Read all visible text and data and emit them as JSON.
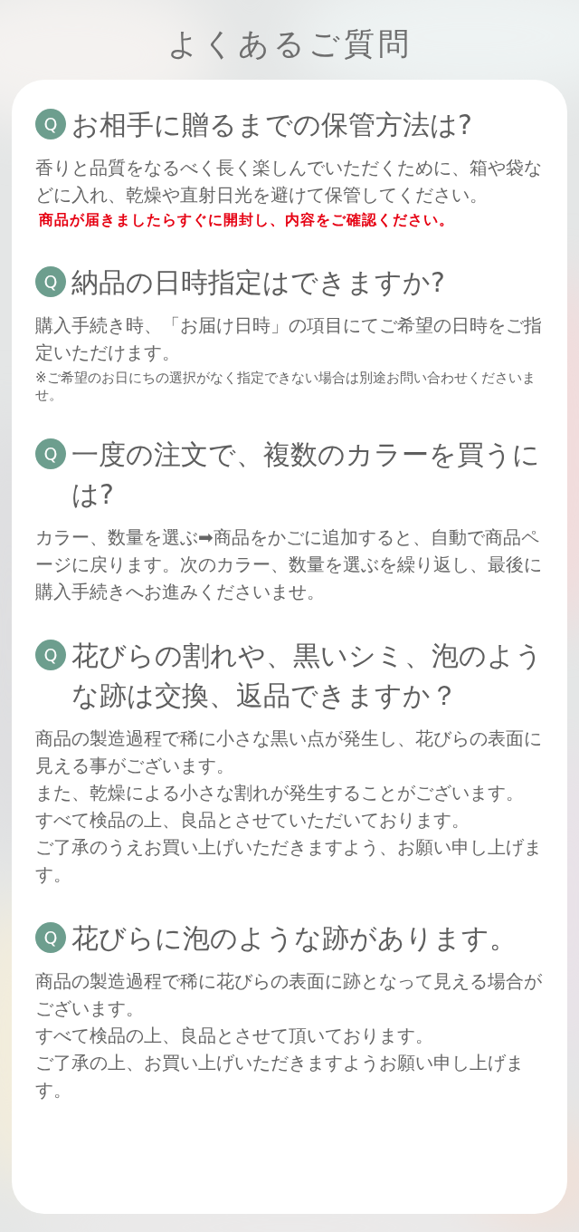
{
  "title": "よくあるご質問",
  "faq": [
    {
      "badge": "Q",
      "question": "お相手に贈るまでの保管方法は?",
      "answers": [
        {
          "kind": "body",
          "text": "香りと品質をなるべく長く楽しんでいただくために、箱や袋などに入れ、乾燥や直射日光を避けて保管してください。"
        },
        {
          "kind": "warning",
          "text": "商品が届きましたらすぐに開封し、内容をご確認ください。"
        }
      ]
    },
    {
      "badge": "Q",
      "question": "納品の日時指定はできますか?",
      "answers": [
        {
          "kind": "body",
          "text": "購入手続き時、「お届け日時」の項目にてご希望の日時をご指定いただけます。"
        },
        {
          "kind": "note",
          "text": "※ご希望のお日にちの選択がなく指定できない場合は別途お問い合わせくださいませ。"
        }
      ]
    },
    {
      "badge": "Q",
      "question": "一度の注文で、複数のカラーを買うには?",
      "answers": [
        {
          "kind": "body",
          "text": "カラー、数量を選ぶ➡商品をかごに追加すると、自動で商品ページに戻ります。次のカラー、数量を選ぶを繰り返し、最後に購入手続きへお進みくださいませ。"
        }
      ]
    },
    {
      "badge": "Q",
      "question": "花びらの割れや、黒いシミ、泡のような跡は交換、返品できますか？",
      "answers": [
        {
          "kind": "body",
          "text": "商品の製造過程で稀に小さな黒い点が発生し、花びらの表面に見える事がございます。"
        },
        {
          "kind": "body",
          "text": "また、乾燥による小さな割れが発生することがございます。"
        },
        {
          "kind": "body",
          "text": "すべて検品の上、良品とさせていただいております。"
        },
        {
          "kind": "body",
          "text": "ご了承のうえお買い上げいただきますよう、お願い申し上げます。"
        }
      ]
    },
    {
      "badge": "Q",
      "question": "花びらに泡のような跡があります。",
      "answers": [
        {
          "kind": "body",
          "text": "商品の製造過程で稀に花びらの表面に跡となって見える場合がございます。"
        },
        {
          "kind": "body",
          "text": "すべて検品の上、良品とさせて頂いております。"
        },
        {
          "kind": "body",
          "text": "ご了承の上、お買い上げいただきますようお願い申し上げます。"
        }
      ]
    }
  ]
}
